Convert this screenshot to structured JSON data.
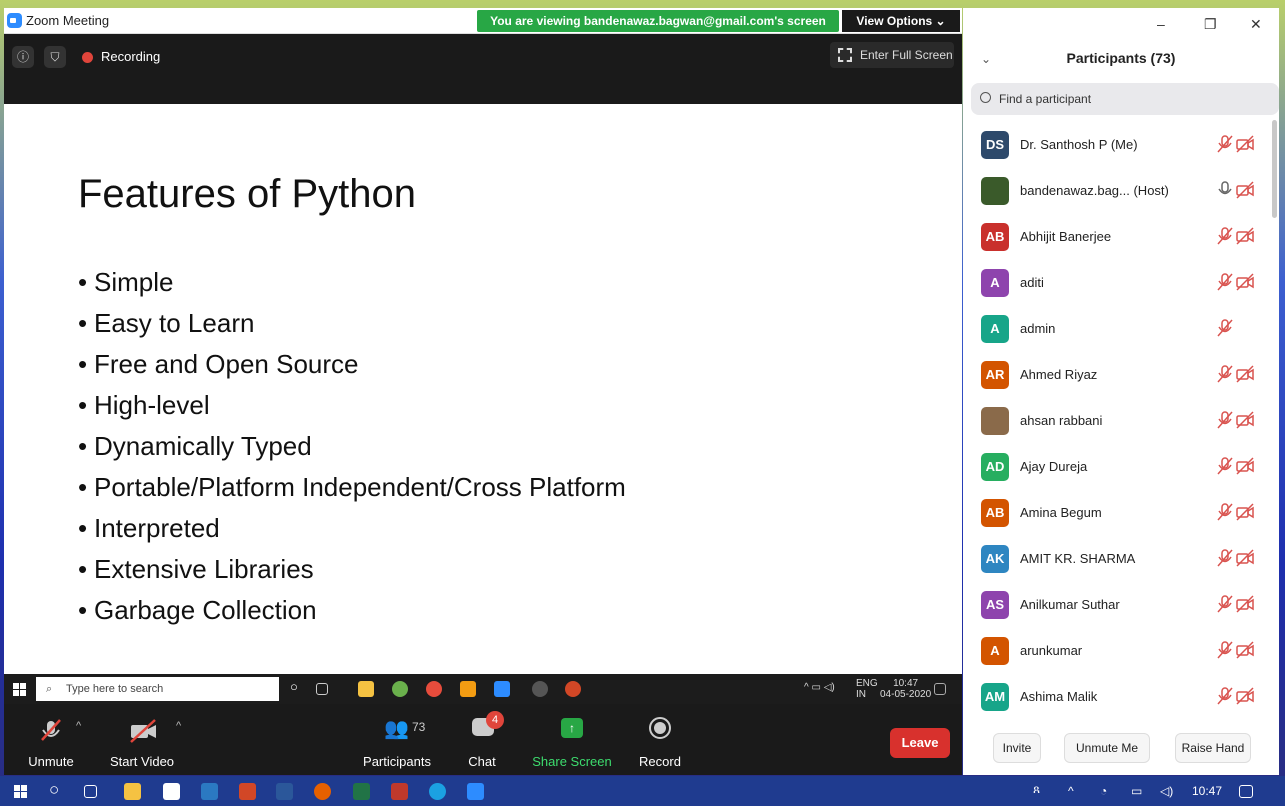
{
  "window": {
    "title": "Zoom Meeting",
    "banner": "You are viewing bandenawaz.bagwan@gmail.com's screen",
    "view_options": "View Options ⌄",
    "recording": "Recording",
    "full_screen": "Enter Full Screen"
  },
  "slide": {
    "title": "Features of Python",
    "bullets": [
      "Simple",
      "Easy to Learn",
      "Free and Open Source",
      "High-level",
      "Dynamically Typed",
      "Portable/Platform Independent/Cross Platform",
      "Interpreted",
      "Extensive Libraries",
      "Garbage Collection"
    ]
  },
  "shared_taskbar": {
    "search_placeholder": "Type here to search",
    "lang": "ENG",
    "region": "IN",
    "time": "10:47",
    "date": "04-05-2020"
  },
  "toolbar": {
    "unmute": "Unmute",
    "start_video": "Start Video",
    "participants": "Participants",
    "participants_count": "73",
    "chat": "Chat",
    "chat_badge": "4",
    "share_screen": "Share Screen",
    "record": "Record",
    "leave": "Leave"
  },
  "panel": {
    "title": "Participants (73)",
    "search_placeholder": "Find a participant",
    "invite": "Invite",
    "unmute_me": "Unmute Me",
    "raise_hand": "Raise Hand",
    "minimize": "–",
    "restore": "❐",
    "close": "✕",
    "collapse": "⌄",
    "participants": [
      {
        "initials": "DS",
        "name": "Dr. Santhosh P (Me)",
        "color": "#2e4a6b",
        "mic": "muted",
        "video": true
      },
      {
        "initials": "",
        "name": "bandenawaz.bag... (Host)",
        "color": "#3a5a2a",
        "mic": "on",
        "video": true,
        "photo": true
      },
      {
        "initials": "AB",
        "name": "Abhijit Banerjee",
        "color": "#c9302c",
        "mic": "muted",
        "video": true
      },
      {
        "initials": "A",
        "name": "aditi",
        "color": "#8e44ad",
        "mic": "muted",
        "video": true
      },
      {
        "initials": "A",
        "name": "admin",
        "color": "#17a589",
        "mic": "muted",
        "video": false
      },
      {
        "initials": "AR",
        "name": "Ahmed Riyaz",
        "color": "#d35400",
        "mic": "muted",
        "video": true
      },
      {
        "initials": "",
        "name": "ahsan rabbani",
        "color": "#8a6a4a",
        "mic": "muted",
        "video": true,
        "photo": true
      },
      {
        "initials": "AD",
        "name": "Ajay Dureja",
        "color": "#27ae60",
        "mic": "muted",
        "video": true
      },
      {
        "initials": "AB",
        "name": "Amina Begum",
        "color": "#d35400",
        "mic": "muted",
        "video": true
      },
      {
        "initials": "AK",
        "name": "AMIT KR. SHARMA",
        "color": "#2e86c1",
        "mic": "muted",
        "video": true
      },
      {
        "initials": "AS",
        "name": "Anilkumar Suthar",
        "color": "#8e44ad",
        "mic": "muted",
        "video": true
      },
      {
        "initials": "A",
        "name": "arunkumar",
        "color": "#d35400",
        "mic": "muted",
        "video": true
      },
      {
        "initials": "AM",
        "name": "Ashima Malik",
        "color": "#17a589",
        "mic": "muted",
        "video": true
      }
    ]
  },
  "taskbar": {
    "time": "10:47"
  }
}
